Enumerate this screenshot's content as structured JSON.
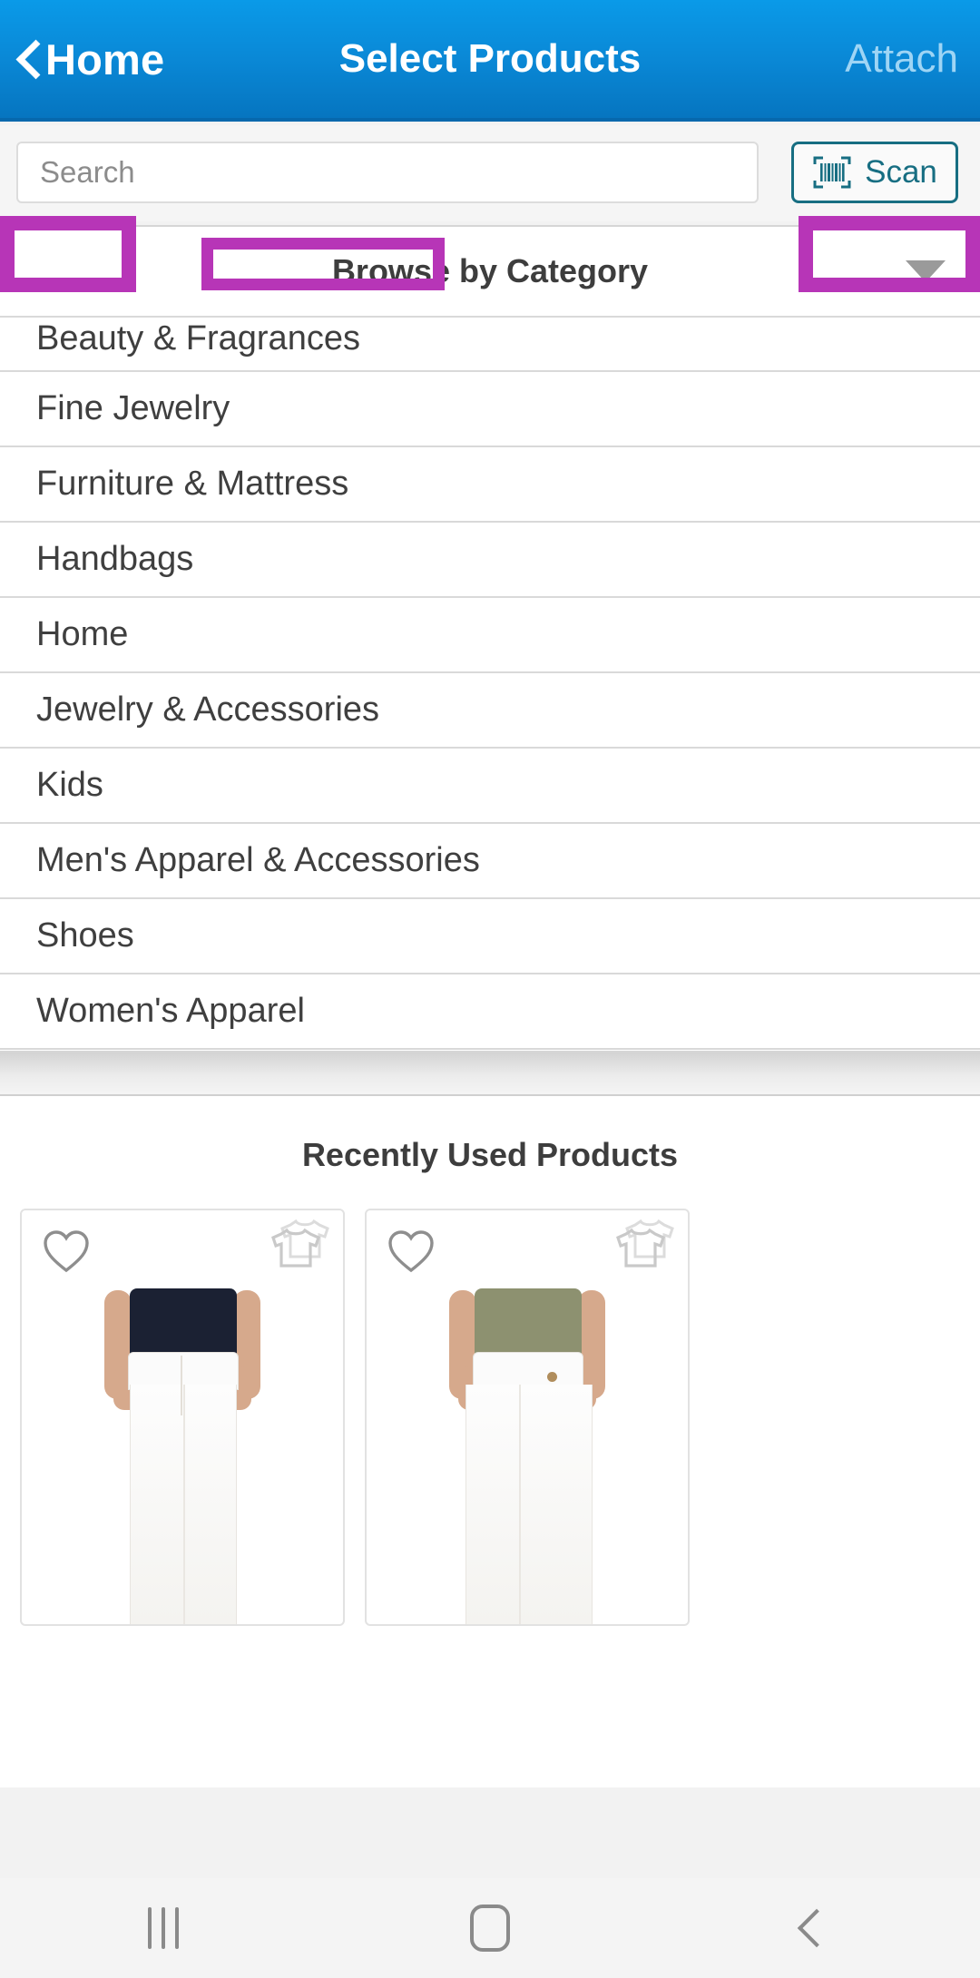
{
  "navbar": {
    "back_label": "Home",
    "title": "Select Products",
    "action_label": "Attach",
    "background_color": "#0a8ad8",
    "back_icon": "chevron-left-icon"
  },
  "search": {
    "placeholder": "Search",
    "value": "",
    "scan_label": "Scan",
    "scan_icon": "barcode-scan-icon",
    "highlight_color": "#b735b7"
  },
  "category_panel": {
    "header_label": "Browse by Category",
    "expand_icon": "caret-down-icon",
    "items": [
      {
        "label": "Beauty & Fragrances"
      },
      {
        "label": "Fine Jewelry"
      },
      {
        "label": "Furniture & Mattress"
      },
      {
        "label": "Handbags"
      },
      {
        "label": "Home"
      },
      {
        "label": "Jewelry & Accessories"
      },
      {
        "label": "Kids"
      },
      {
        "label": "Men's Apparel & Accessories"
      },
      {
        "label": "Shoes"
      },
      {
        "label": "Women's Apparel"
      }
    ]
  },
  "recent_section": {
    "title": "Recently Used Products",
    "cards": [
      {
        "favorite_icon": "heart-outline-icon",
        "variant_icon": "tshirt-stack-icon",
        "image_alt": "white skinny jeans on model"
      },
      {
        "favorite_icon": "heart-outline-icon",
        "variant_icon": "tshirt-stack-icon",
        "image_alt": "white cargo pants on model"
      }
    ]
  },
  "system_nav": {
    "recents_icon": "recents-bars-icon",
    "home_icon": "home-square-icon",
    "back_icon": "back-chevron-icon"
  }
}
